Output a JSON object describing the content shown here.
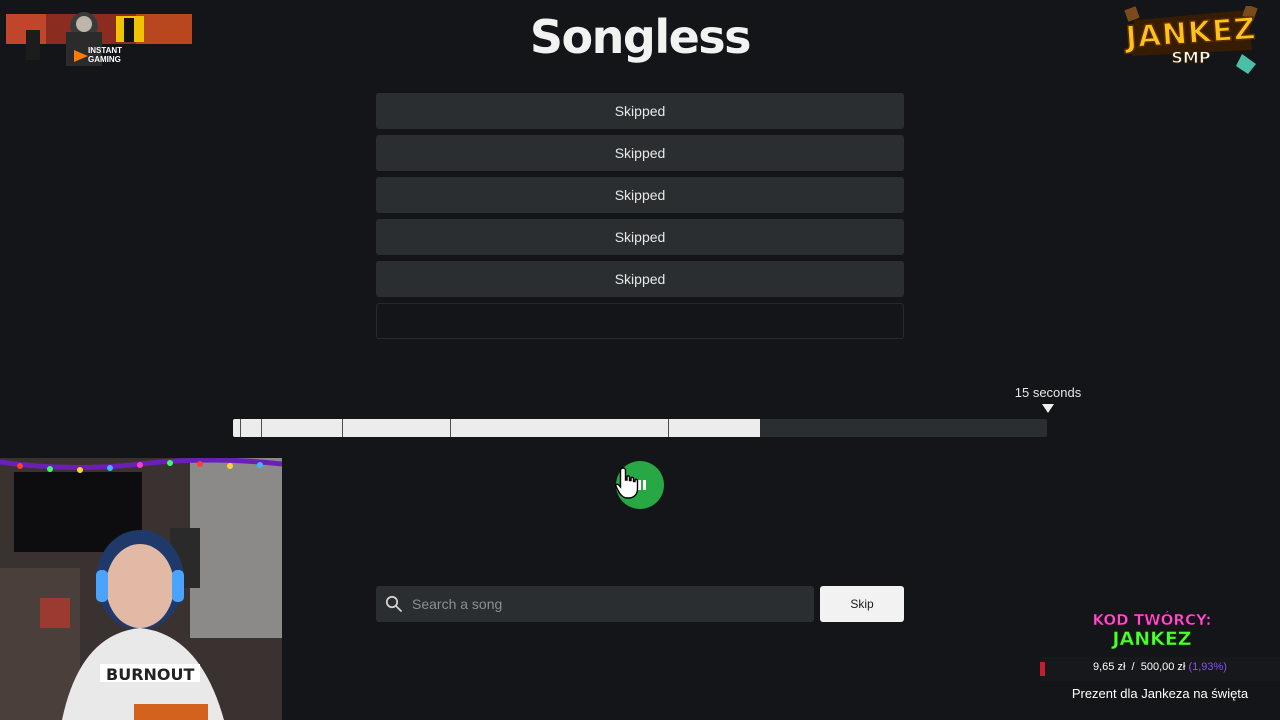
{
  "app": {
    "title": "Songless"
  },
  "guesses": [
    {
      "label": "Skipped"
    },
    {
      "label": "Skipped"
    },
    {
      "label": "Skipped"
    },
    {
      "label": "Skipped"
    },
    {
      "label": "Skipped"
    },
    {
      "label": ""
    }
  ],
  "timeline": {
    "max_label": "15 seconds",
    "progress_fraction": 0.648,
    "segment_fractions": [
      0.008,
      0.035,
      0.134,
      0.267,
      0.534
    ]
  },
  "player": {
    "play_icon": "play-icon",
    "accent_color": "#28a745"
  },
  "search": {
    "placeholder": "Search a song",
    "value": "",
    "icon": "search-icon"
  },
  "skip_button": {
    "label": "Skip"
  },
  "overlays": {
    "sponsor_logo_text": "INSTANT\nGAMING",
    "server_logo_title": "JANKEZ",
    "server_logo_sub": "SMP",
    "creator_code_label": "KOD TWÓRCY:",
    "creator_code_value": "JANKEZ",
    "goal": {
      "current": "9,65 zł",
      "separator": "/",
      "target": "500,00 zł",
      "percent": "(1,93%)",
      "fraction": 0.0193,
      "title": "Prezent dla Jankeza na święta"
    }
  },
  "colors": {
    "background": "#131518",
    "panel": "#2a2e31",
    "text": "#f2f2f2",
    "play": "#28a745"
  }
}
